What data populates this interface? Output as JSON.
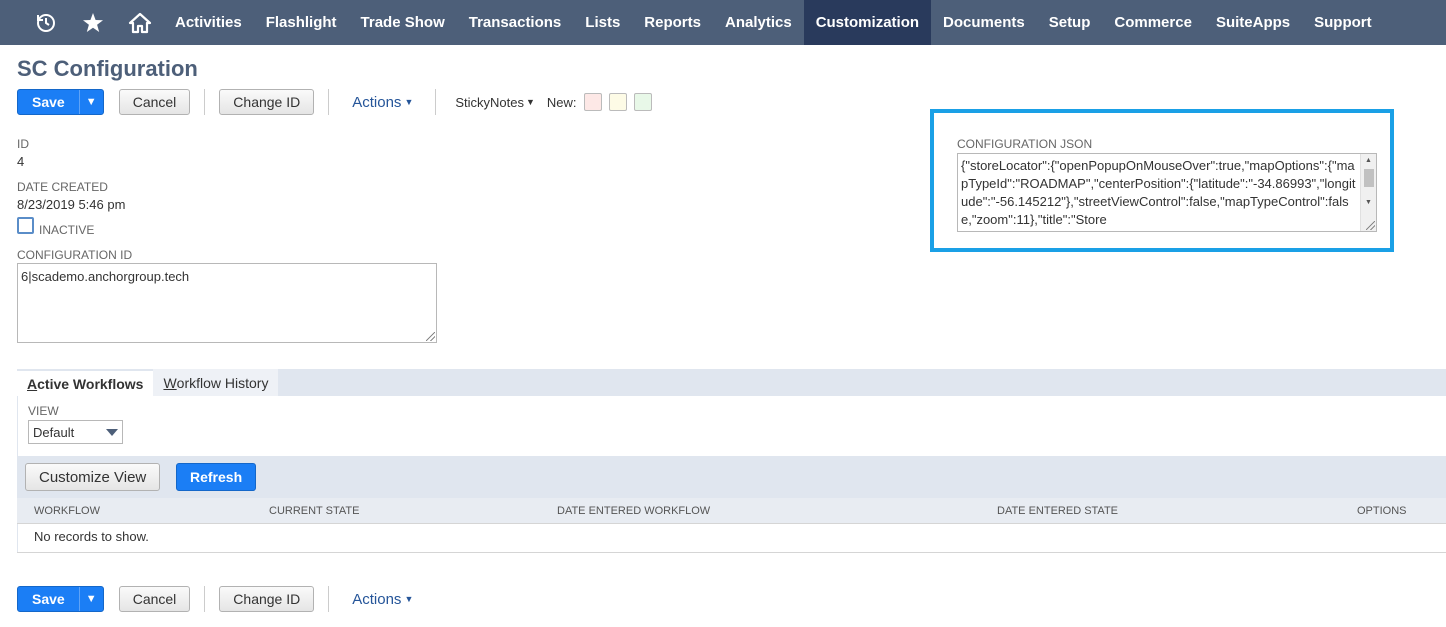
{
  "nav": {
    "icons": [
      "recent-icon",
      "star-icon",
      "home-icon"
    ],
    "items": [
      "Activities",
      "Flashlight",
      "Trade Show",
      "Transactions",
      "Lists",
      "Reports",
      "Analytics",
      "Customization",
      "Documents",
      "Setup",
      "Commerce",
      "SuiteApps",
      "Support"
    ],
    "active": "Customization"
  },
  "page": {
    "title": "SC Configuration"
  },
  "toolbar": {
    "save": "Save",
    "cancel": "Cancel",
    "change_id": "Change ID",
    "actions": "Actions",
    "sticky_notes": "StickyNotes",
    "new_label": "New:",
    "note_colors": [
      "#fde8e6",
      "#fdfbe6",
      "#e8f8e8"
    ]
  },
  "fields": {
    "id_label": "ID",
    "id_value": "4",
    "date_created_label": "DATE CREATED",
    "date_created_value": "8/23/2019 5:46 pm",
    "inactive_label": "INACTIVE",
    "config_id_label": "CONFIGURATION ID",
    "config_id_value": "6|scademo.anchorgroup.tech",
    "config_json_label": "CONFIGURATION JSON",
    "config_json_value": "{\"storeLocator\":{\"openPopupOnMouseOver\":true,\"mapOptions\":{\"mapTypeId\":\"ROADMAP\",\"centerPosition\":{\"latitude\":\"-34.86993\",\"longitude\":\"-56.145212\"},\"streetViewControl\":false,\"mapTypeControl\":false,\"zoom\":11},\"title\":\"Store"
  },
  "subtabs": {
    "active_workflows": {
      "first": "A",
      "rest": "ctive Workflows"
    },
    "workflow_history": {
      "first": "W",
      "rest": "orkflow History"
    }
  },
  "workflows": {
    "view_label": "VIEW",
    "view_value": "Default",
    "customize_view": "Customize View",
    "refresh": "Refresh",
    "columns": [
      "WORKFLOW",
      "CURRENT STATE",
      "DATE ENTERED WORKFLOW",
      "DATE ENTERED STATE",
      "OPTIONS"
    ],
    "empty": "No records to show."
  },
  "colors": {
    "nav_bg": "#4d5f79",
    "nav_active": "#293a5c",
    "primary": "#1b7ef5",
    "highlight": "#1aa0e6"
  }
}
